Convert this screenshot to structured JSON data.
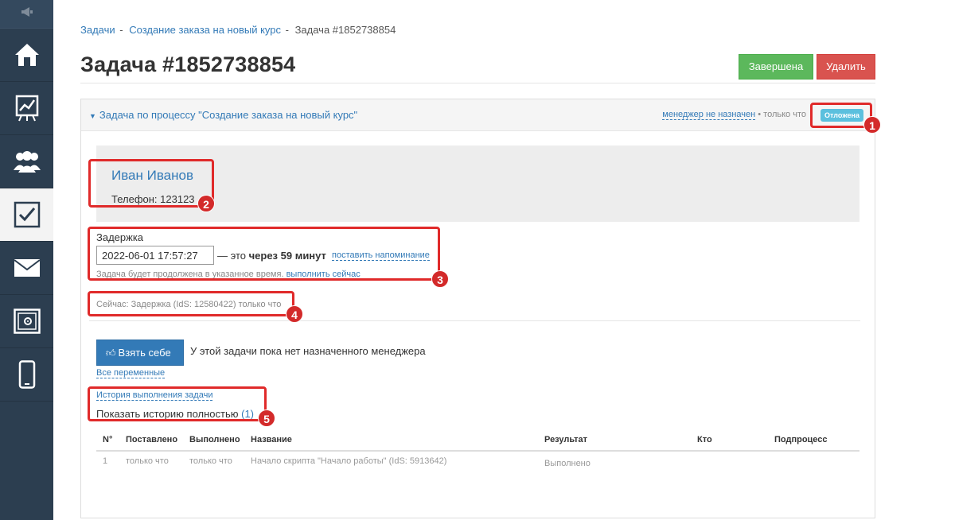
{
  "sidebar": {
    "items": [
      {
        "icon": "megaphone-icon",
        "active": false
      },
      {
        "icon": "home-icon",
        "active": false
      },
      {
        "icon": "chart-board-icon",
        "active": false
      },
      {
        "icon": "users-icon",
        "active": false
      },
      {
        "icon": "checkbox-icon",
        "active": true
      },
      {
        "icon": "envelope-icon",
        "active": false
      },
      {
        "icon": "safe-icon",
        "active": false
      },
      {
        "icon": "phone-icon",
        "active": false
      }
    ]
  },
  "breadcrumb": {
    "items": [
      "Задачи",
      "Создание заказа на новый курс"
    ],
    "current": "Задача #1852738854",
    "separator": "-"
  },
  "header": {
    "title": "Задача #1852738854",
    "done_label": "Завершена",
    "delete_label": "Удалить"
  },
  "panel": {
    "title": "Задача по процессу \"Создание заказа на новый курс\"",
    "manager_link": "менеджер не назначен",
    "meta_sep": " • ",
    "time": "только что",
    "badge": "Отложена"
  },
  "client": {
    "name": "Иван Иванов",
    "phone": "Телефон: 123123"
  },
  "delay": {
    "label": "Задержка",
    "value": "2022-06-01 17:57:27",
    "prefix": "— это ",
    "bold": "через 59 минут",
    "reminder_link": "поставить напоминание",
    "note": "Задача будет продолжена в указанное время.",
    "now_link": " выполнить сейчас"
  },
  "current_status": "Сейчас: Задержка (IdS: 12580422) только что",
  "take": {
    "button_label": "Взять себе",
    "no_manager_text": "У этой задачи пока нет назначенного менеджера",
    "all_vars_link": "Все переменные"
  },
  "history": {
    "link": "История выполнения задачи",
    "full_label": "Показать историю полностью",
    "count": "(1)",
    "columns": [
      "N°",
      "Поставлено",
      "Выполнено",
      "Название",
      "Результат",
      "Кто",
      "Подпроцесс"
    ],
    "rows": [
      [
        "1",
        "только что",
        "только что",
        "Начало скрипта \"Начало работы\" (IdS: 5913642)",
        "Выполнено",
        "",
        ""
      ]
    ]
  },
  "annotations": [
    "1",
    "2",
    "3",
    "4",
    "5"
  ],
  "colors": {
    "sidebar_bg": "#2c3e50",
    "link": "#337ab7",
    "success": "#5cb85c",
    "danger": "#d9534f",
    "info_badge": "#5bc0de",
    "annotation": "#e02a2a"
  }
}
